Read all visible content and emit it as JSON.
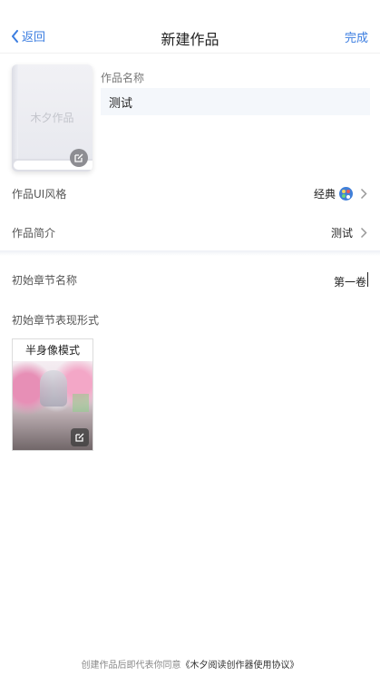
{
  "nav": {
    "back_label": "返回",
    "title": "新建作品",
    "done_label": "完成",
    "accent": "#3b7de0"
  },
  "cover": {
    "placeholder_text": "木夕作品"
  },
  "work_name": {
    "label": "作品名称",
    "value": "测试"
  },
  "ui_style": {
    "label": "作品UI风格",
    "value": "经典"
  },
  "intro": {
    "label": "作品简介",
    "value": "测试"
  },
  "chapter_name": {
    "label": "初始章节名称",
    "value": "第一卷"
  },
  "chapter_format": {
    "label": "初始章节表现形式",
    "mode_label": "半身像模式"
  },
  "footer": {
    "prefix": "创建作品后即代表你同意",
    "link": "《木夕阅读创作器使用协议》"
  }
}
